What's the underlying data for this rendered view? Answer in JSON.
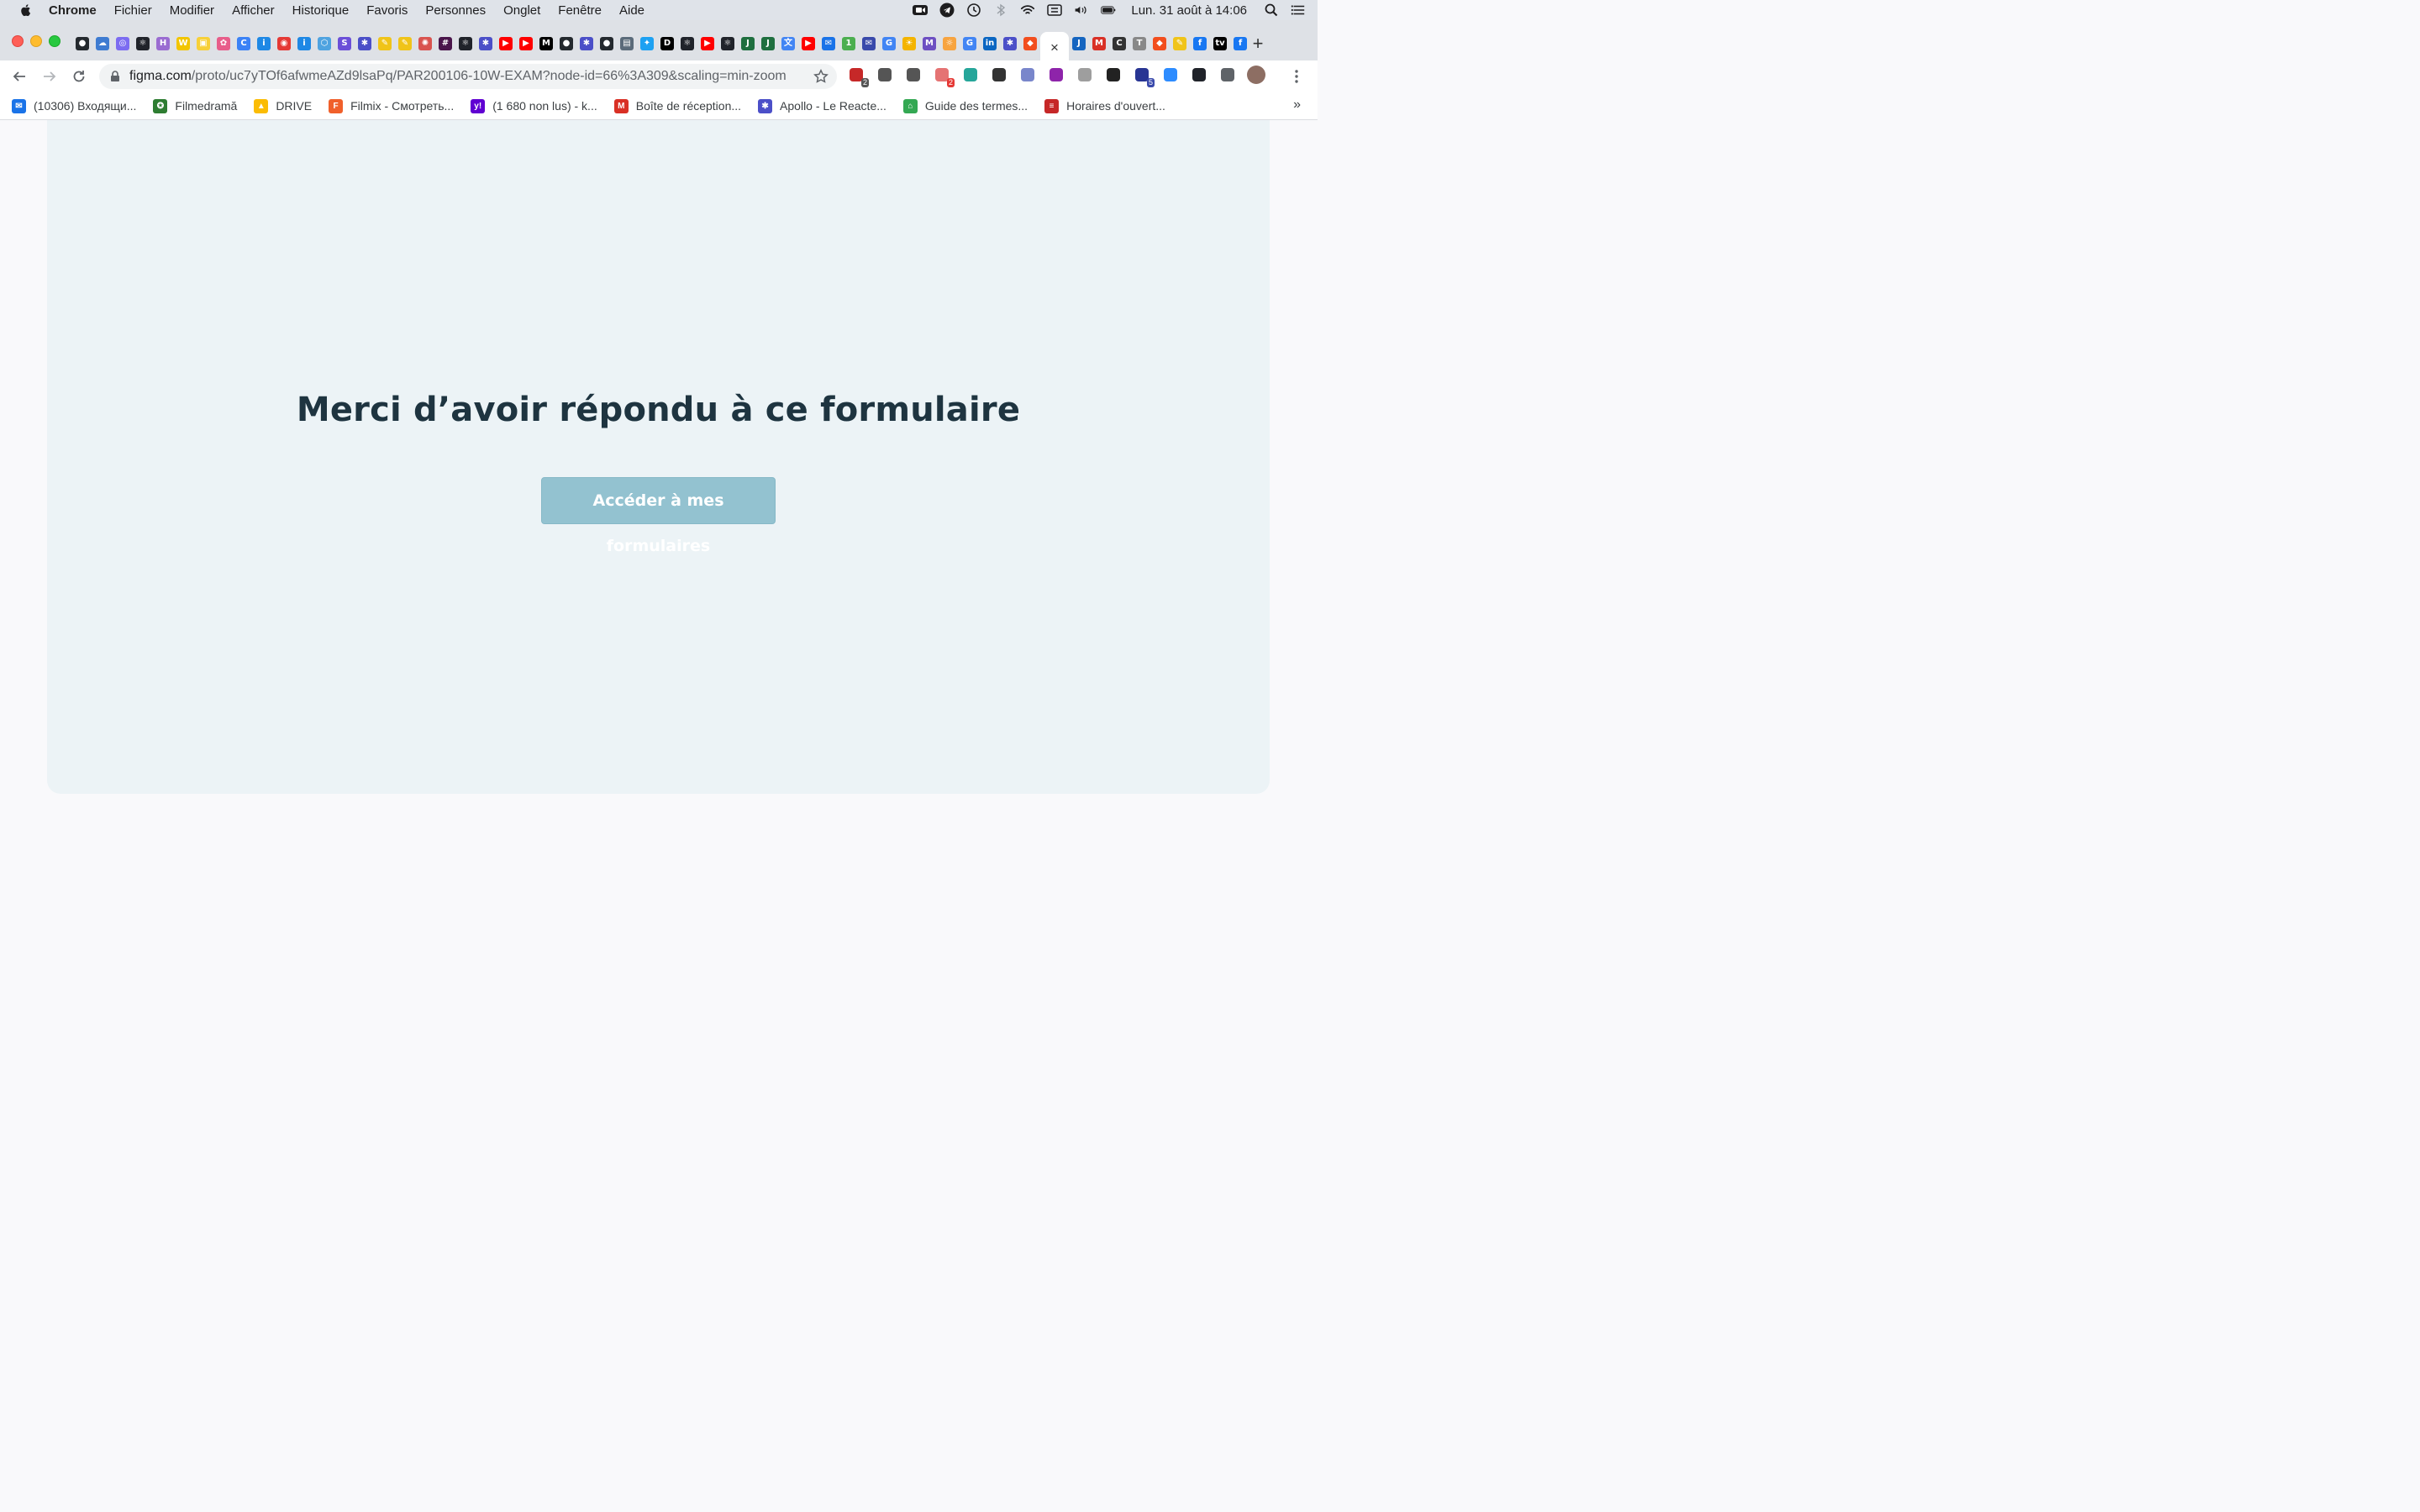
{
  "menubar": {
    "app_name": "Chrome",
    "items": [
      "Fichier",
      "Modifier",
      "Afficher",
      "Historique",
      "Favoris",
      "Personnes",
      "Onglet",
      "Fenêtre",
      "Aide"
    ],
    "clock": "Lun. 31 août à 14:06",
    "status_icons": [
      "zoom-icon",
      "telegram-icon",
      "time-machine-icon",
      "bluetooth-icon",
      "wifi-icon",
      "keyboard-icon",
      "volume-icon",
      "battery-icon",
      "search-icon",
      "control-center-icon"
    ]
  },
  "tabs": {
    "favicons": [
      {
        "icon": "github-icon",
        "color": "#24292e",
        "glyph": "●"
      },
      {
        "icon": "cloud-icon",
        "color": "#3e7bd1",
        "glyph": "☁"
      },
      {
        "icon": "ring-icon",
        "color": "#7c6cf1",
        "glyph": "◎"
      },
      {
        "icon": "react-icon",
        "color": "#20232a",
        "glyph": "⚛"
      },
      {
        "icon": "h-icon",
        "color": "#9a6cd1",
        "glyph": "H"
      },
      {
        "icon": "w-icon",
        "color": "#f2c500",
        "glyph": "W"
      },
      {
        "icon": "bag-icon",
        "color": "#f7d038",
        "glyph": "▣"
      },
      {
        "icon": "flower-icon",
        "color": "#e85d8a",
        "glyph": "✿"
      },
      {
        "icon": "c-icon",
        "color": "#3b82f6",
        "glyph": "C"
      },
      {
        "icon": "info-icon",
        "color": "#1e88e5",
        "glyph": "i"
      },
      {
        "icon": "record-icon",
        "color": "#e53935",
        "glyph": "◉"
      },
      {
        "icon": "info-icon",
        "color": "#1e88e5",
        "glyph": "i"
      },
      {
        "icon": "hex-icon",
        "color": "#4fa3e0",
        "glyph": "⬡"
      },
      {
        "icon": "s-icon",
        "color": "#6b4fd8",
        "glyph": "S"
      },
      {
        "icon": "apollo-icon",
        "color": "#4b4fc8",
        "glyph": "✱"
      },
      {
        "icon": "pen-icon",
        "color": "#f0c419",
        "glyph": "✎"
      },
      {
        "icon": "pen-icon",
        "color": "#f0c419",
        "glyph": "✎"
      },
      {
        "icon": "openai-icon",
        "color": "#d9534f",
        "glyph": "✺"
      },
      {
        "icon": "slack-icon",
        "color": "#4a154b",
        "glyph": "#"
      },
      {
        "icon": "react-icon",
        "color": "#20232a",
        "glyph": "⚛"
      },
      {
        "icon": "apollo-icon",
        "color": "#4b4fc8",
        "glyph": "✱"
      },
      {
        "icon": "youtube-icon",
        "color": "#ff0000",
        "glyph": "▶"
      },
      {
        "icon": "youtube-icon",
        "color": "#ff0000",
        "glyph": "▶"
      },
      {
        "icon": "medium-icon",
        "color": "#000000",
        "glyph": "M"
      },
      {
        "icon": "github-icon",
        "color": "#24292e",
        "glyph": "●"
      },
      {
        "icon": "apollo-icon",
        "color": "#4b4fc8",
        "glyph": "✱"
      },
      {
        "icon": "github-icon",
        "color": "#24292e",
        "glyph": "●"
      },
      {
        "icon": "film-icon",
        "color": "#5b6b7a",
        "glyph": "▤"
      },
      {
        "icon": "twitter-icon",
        "color": "#1da1f2",
        "glyph": "✦"
      },
      {
        "icon": "dev-icon",
        "color": "#000000",
        "glyph": "D"
      },
      {
        "icon": "react-icon",
        "color": "#20232a",
        "glyph": "⚛"
      },
      {
        "icon": "youtube-icon",
        "color": "#ff0000",
        "glyph": "▶"
      },
      {
        "icon": "react-icon",
        "color": "#20232a",
        "glyph": "⚛"
      },
      {
        "icon": "js-icon",
        "color": "#1f6f3f",
        "glyph": "J"
      },
      {
        "icon": "js-icon",
        "color": "#1f6f3f",
        "glyph": "J"
      },
      {
        "icon": "translate-icon",
        "color": "#4285f4",
        "glyph": "文"
      },
      {
        "icon": "youtube-icon",
        "color": "#ff0000",
        "glyph": "▶"
      },
      {
        "icon": "mail-icon",
        "color": "#1a73e8",
        "glyph": "✉"
      },
      {
        "icon": "numbers-icon",
        "color": "#4caf50",
        "glyph": "1"
      },
      {
        "icon": "mail-icon",
        "color": "#3949ab",
        "glyph": "✉"
      },
      {
        "icon": "google-icon",
        "color": "#4285f4",
        "glyph": "G"
      },
      {
        "icon": "sun-icon",
        "color": "#f4b400",
        "glyph": "☀"
      },
      {
        "icon": "m-icon",
        "color": "#6d4fc2",
        "glyph": "M"
      },
      {
        "icon": "weather-icon",
        "color": "#f7a440",
        "glyph": "☼"
      },
      {
        "icon": "translate-icon",
        "color": "#4285f4",
        "glyph": "G"
      },
      {
        "icon": "linkedin-icon",
        "color": "#0a66c2",
        "glyph": "in"
      },
      {
        "icon": "apollo-icon",
        "color": "#4b4fc8",
        "glyph": "✱"
      },
      {
        "icon": "figma-icon",
        "color": "#f24e1e",
        "glyph": "◆"
      }
    ],
    "active_tab_close": "×",
    "trailing_favicons": [
      {
        "icon": "j-icon",
        "color": "#1565c0",
        "glyph": "J"
      },
      {
        "icon": "gmail-icon",
        "color": "#d93025",
        "glyph": "M"
      },
      {
        "icon": "c-icon",
        "color": "#333333",
        "glyph": "C"
      },
      {
        "icon": "t-icon",
        "color": "#888888",
        "glyph": "T"
      },
      {
        "icon": "figma-icon",
        "color": "#f24e1e",
        "glyph": "◆"
      },
      {
        "icon": "pen-icon",
        "color": "#f0c419",
        "glyph": "✎"
      },
      {
        "icon": "facebook-icon",
        "color": "#1877f2",
        "glyph": "f"
      },
      {
        "icon": "appletv-icon",
        "color": "#000000",
        "glyph": "tv"
      },
      {
        "icon": "facebook-icon",
        "color": "#1877f2",
        "glyph": "f"
      }
    ],
    "new_tab_label": "+"
  },
  "toolbar": {
    "url_host": "figma.com",
    "url_path": "/proto/uc7yTOf6afwmeAZd9lsaPq/PAR200106-10W-EXAM?node-id=66%3A309&scaling=min-zoom",
    "extensions": [
      {
        "icon": "adblock-icon",
        "color": "#c62828",
        "badge": "2",
        "badge_color": "#555555"
      },
      {
        "icon": "eyedropper-icon",
        "color": "#555555",
        "badge": "",
        "badge_color": ""
      },
      {
        "icon": "move-icon",
        "color": "#555555",
        "badge": "",
        "badge_color": ""
      },
      {
        "icon": "ruler-icon",
        "color": "#e57373",
        "badge": "2",
        "badge_color": "#e53935"
      },
      {
        "icon": "bird-icon",
        "color": "#26a69a",
        "badge": "",
        "badge_color": ""
      },
      {
        "icon": "json-icon",
        "color": "#333333",
        "badge": "",
        "badge_color": ""
      },
      {
        "icon": "lighthouse-icon",
        "color": "#7986cb",
        "badge": "",
        "badge_color": ""
      },
      {
        "icon": "broadcast-icon",
        "color": "#8e24aa",
        "badge": "",
        "badge_color": ""
      },
      {
        "icon": "shield-icon",
        "color": "#9e9e9e",
        "badge": "",
        "badge_color": ""
      },
      {
        "icon": "image-icon",
        "color": "#222222",
        "badge": "",
        "badge_color": ""
      },
      {
        "icon": "graduation-icon",
        "color": "#283593",
        "badge": "5",
        "badge_color": "#3949ab"
      },
      {
        "icon": "zoom-icon",
        "color": "#2d8cff",
        "badge": "",
        "badge_color": ""
      },
      {
        "icon": "react-icon",
        "color": "#20232a",
        "badge": "",
        "badge_color": ""
      },
      {
        "icon": "puzzle-icon",
        "color": "#5f6368",
        "badge": "",
        "badge_color": ""
      },
      {
        "icon": "avatar-icon",
        "color": "#8d6e63",
        "badge": "",
        "badge_color": ""
      }
    ]
  },
  "bookmarks": [
    {
      "label": "(10306) Входящи...",
      "icon": "mail-icon",
      "color": "#1a73e8",
      "glyph": "✉"
    },
    {
      "label": "Filmedramă",
      "icon": "film-icon",
      "color": "#2e7d32",
      "glyph": "✪"
    },
    {
      "label": "DRIVE",
      "icon": "drive-icon",
      "color": "#fbbc04",
      "glyph": "▲"
    },
    {
      "label": "Filmix - Смотреть...",
      "icon": "filmix-icon",
      "color": "#f0602b",
      "glyph": "F"
    },
    {
      "label": "(1 680 non lus) - k...",
      "icon": "yahoo-icon",
      "color": "#6001d2",
      "glyph": "y!"
    },
    {
      "label": "Boîte de réception...",
      "icon": "gmail-icon",
      "color": "#d93025",
      "glyph": "M"
    },
    {
      "label": "Apollo - Le Reacte...",
      "icon": "apollo-icon",
      "color": "#4b4fc8",
      "glyph": "✱"
    },
    {
      "label": "Guide des termes...",
      "icon": "house-icon",
      "color": "#34a853",
      "glyph": "⌂"
    },
    {
      "label": "Horaires d'ouvert...",
      "icon": "horaires-icon",
      "color": "#c62828",
      "glyph": "≡"
    }
  ],
  "bookmarks_more": "»",
  "page": {
    "heading": "Merci d’avoir répondu à ce formulaire",
    "button_label": "Accéder à mes formulaires"
  }
}
